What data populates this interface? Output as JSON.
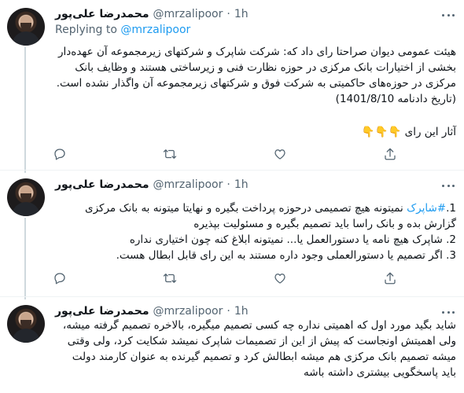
{
  "tweets": [
    {
      "author_name": "محمدرضا علی‌پور",
      "handle": "@mrzalipoor",
      "dot": "·",
      "time": "1h",
      "replying_prefix": "Replying to",
      "replying_mention": "@mrzalipoor",
      "paragraph1": "هیئت عمومی دیوان صراحتا رای داد که: شرکت شاپرک و شرکتهای زیرمجموعه آن عهده‌دار بخشی از اختیارات بانک مرکزی در حوزه نظارت فنی و زیرساختی هستند و وظایف بانک مرکزی در حوزه‌های حاکمیتی به شرکت فوق و شرکتهای زیرمجموعه آن واگذار نشده است. (تاریخ دادنامه 1401/8/10)",
      "paragraph2": "آثار این رای",
      "emojis": "👇👇👇"
    },
    {
      "author_name": "محمدرضا علی‌پور",
      "handle": "@mrzalipoor",
      "dot": "·",
      "time": "1h",
      "line1_prefix": "1.",
      "line1_hashtag": "#شاپرک",
      "line1_rest": "نمیتونه هیچ تصمیمی درحوزه پرداخت بگیره و نهایتا میتونه به بانک مرکزی گزارش بده و بانک راسا باید تصمیم بگیره و مسئولیت بپذیره",
      "line2": "2. شاپرک هیچ نامه یا دستورالعمل یا... نمیتونه ابلاغ کنه چون اختیاری نداره",
      "line3": "3. اگر تصمیم یا دستورالعملی وجود داره مستند به این رای قابل ابطال هست."
    },
    {
      "author_name": "محمدرضا علی‌پور",
      "handle": "@mrzalipoor",
      "dot": "·",
      "time": "1h",
      "text": "شاید بگید مورد اول که اهمیتی نداره چه کسی تصمیم میگیره، بالاخره تصمیم گرفته میشه، ولی اهمیتش اونجاست که پیش از این از تصمیمات شاپرک نمیشد شکایت کرد، ولی وقتی میشه تصمیم بانک مرکزی هم میشه ابطالش کرد و تصمیم گیرنده به عنوان کارمند دولت باید پاسخگویی بیشتری داشته باشه"
    }
  ],
  "colors": {
    "link": "#1d9bf0",
    "secondary_text": "#536471",
    "primary_text": "#0f1419",
    "divider": "#eff3f4"
  },
  "icons": [
    "reply-icon",
    "retweet-icon",
    "like-icon",
    "share-icon",
    "more-icon"
  ]
}
